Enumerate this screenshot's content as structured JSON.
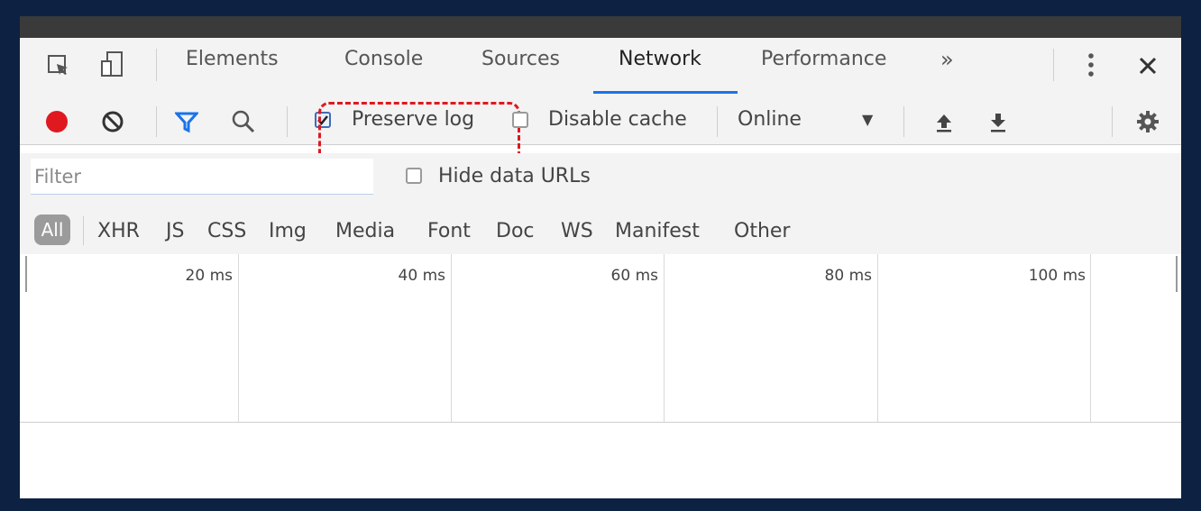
{
  "tabs": [
    {
      "label": "Elements"
    },
    {
      "label": "Console"
    },
    {
      "label": "Sources"
    },
    {
      "label": "Network"
    },
    {
      "label": "Performance"
    }
  ],
  "tab_overflow": "»",
  "toolbar": {
    "preserve_log": "Preserve log",
    "disable_cache": "Disable cache",
    "throttle": "Online",
    "throttle_arrow": "▼"
  },
  "filter": {
    "placeholder": "Filter",
    "value": ""
  },
  "hide_data_urls": "Hide data URLs",
  "types": [
    "All",
    "XHR",
    "JS",
    "CSS",
    "Img",
    "Media",
    "Font",
    "Doc",
    "WS",
    "Manifest",
    "Other"
  ],
  "timeline_ticks": [
    "20 ms",
    "40 ms",
    "60 ms",
    "80 ms",
    "100 ms"
  ],
  "colors": {
    "record": "#e0181f",
    "filter": "#1a73e8",
    "highlight": "#e0181f",
    "active_tab": "#1a73e8"
  }
}
